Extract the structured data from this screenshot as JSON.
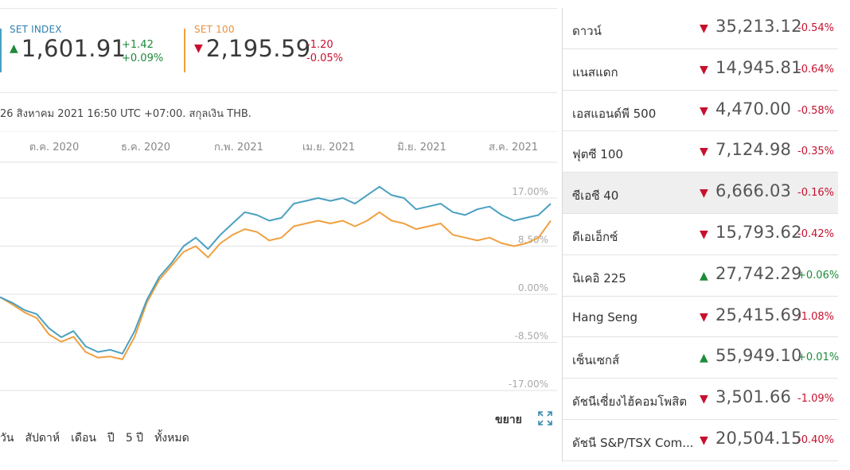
{
  "indices": [
    {
      "label": "SET INDEX",
      "direction": "up",
      "value": "1,601.91",
      "change": "+1.42",
      "pct": "+0.09%",
      "color": "#4aa0c0"
    },
    {
      "label": "SET 100",
      "direction": "down",
      "value": "2,195.59",
      "change": "-1.20",
      "pct": "-0.05%",
      "color": "#f0a040"
    }
  ],
  "as_of": "26 สิงหาคม 2021 16:50 UTC +07:00. สกุลเงิน THB.",
  "chart_data": {
    "type": "line",
    "x_ticks": [
      "ต.ค. 2020",
      "ธ.ค. 2020",
      "ก.พ. 2021",
      "เม.ย. 2021",
      "มิ.ย. 2021",
      "ส.ค. 2021"
    ],
    "y_ticks": [
      "17.00%",
      "8.50%",
      "0.00%",
      "-8.50%",
      "-17.00%"
    ],
    "ylim": [
      -17,
      20
    ],
    "series": [
      {
        "name": "SET INDEX",
        "color": "#4aa0c0",
        "values": [
          -0.5,
          -1.5,
          -2.8,
          -3.5,
          -6,
          -7.6,
          -6.5,
          -9.2,
          -10.2,
          -9.8,
          -10.5,
          -6.5,
          -1,
          3,
          5.5,
          8.5,
          10,
          8,
          10.5,
          12.5,
          14.5,
          14,
          13,
          13.5,
          16,
          16.5,
          17,
          16.5,
          17,
          16,
          17.5,
          19,
          17.5,
          17,
          15,
          15.5,
          16,
          14.5,
          14,
          15,
          15.5,
          14,
          13,
          13.5,
          14,
          16
        ]
      },
      {
        "name": "SET 100",
        "color": "#f0a040",
        "values": [
          -0.5,
          -1.8,
          -3.2,
          -4.2,
          -7.1,
          -8.4,
          -7.5,
          -10.2,
          -11.2,
          -11,
          -11.5,
          -7.5,
          -1.5,
          2.5,
          5,
          7.5,
          8.5,
          6.5,
          9,
          10.5,
          11.5,
          11,
          9.5,
          10,
          12,
          12.5,
          13,
          12.5,
          13,
          12,
          13,
          14.5,
          13,
          12.5,
          11.5,
          12,
          12.5,
          10.5,
          10,
          9.5,
          10,
          9,
          8.5,
          9,
          10,
          13
        ]
      }
    ]
  },
  "expand_label": "ขยาย",
  "ranges": [
    "วัน",
    "สัปดาห์",
    "เดือน",
    "ปี",
    "5 ปี",
    "ทั้งหมด"
  ],
  "markets": [
    {
      "name": "ดาวน์",
      "dir": "down",
      "value": "35,213.12",
      "pct": "-0.54%"
    },
    {
      "name": "แนสแดก",
      "dir": "down",
      "value": "14,945.81",
      "pct": "-0.64%"
    },
    {
      "name": "เอสแอนด์พี 500",
      "dir": "down",
      "value": "4,470.00",
      "pct": "-0.58%"
    },
    {
      "name": "ฟุตซี 100",
      "dir": "down",
      "value": "7,124.98",
      "pct": "-0.35%"
    },
    {
      "name": "ซีเอซี 40",
      "dir": "down",
      "value": "6,666.03",
      "pct": "-0.16%",
      "highlight": true
    },
    {
      "name": "ดีเอเอ็กซ์",
      "dir": "down",
      "value": "15,793.62",
      "pct": "-0.42%"
    },
    {
      "name": "นิเคอิ 225",
      "dir": "up",
      "value": "27,742.29",
      "pct": "+0.06%"
    },
    {
      "name": "Hang Seng",
      "dir": "down",
      "value": "25,415.69",
      "pct": "-1.08%"
    },
    {
      "name": "เซ็นเซกส์",
      "dir": "up",
      "value": "55,949.10",
      "pct": "+0.01%"
    },
    {
      "name": "ดัชนีเซี่ยงไฮ้คอมโพสิต",
      "dir": "down",
      "value": "3,501.66",
      "pct": "-1.09%"
    },
    {
      "name": "ดัชนี S&P/TSX Com...",
      "dir": "down",
      "value": "20,504.15",
      "pct": "-0.40%"
    }
  ]
}
